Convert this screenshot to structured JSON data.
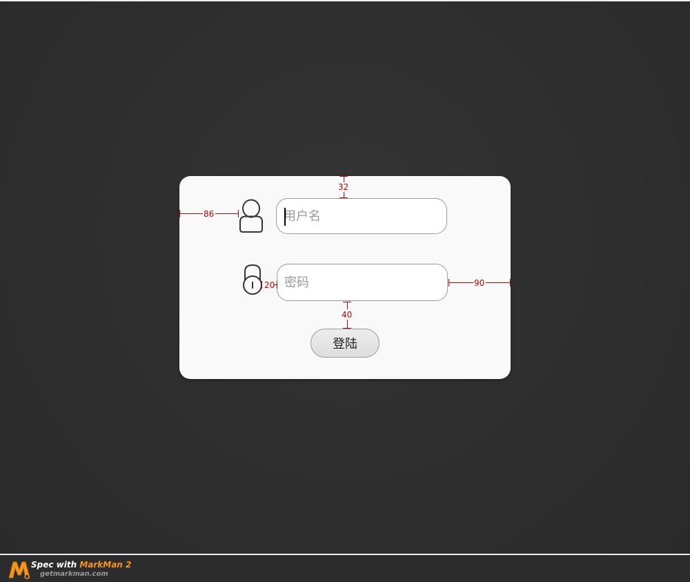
{
  "login_form": {
    "username": {
      "value": "",
      "placeholder": "用户名"
    },
    "password": {
      "value": "",
      "placeholder": "密码"
    },
    "login_label": "登陆"
  },
  "annotations": {
    "top_spacing": "32",
    "left_spacing": "86",
    "icon_gap": "20",
    "right_spacing": "90",
    "button_gap": "40"
  },
  "footer": {
    "spec_prefix": "Spec with ",
    "brand": "MarkMan 2",
    "url": "getmarkman.com"
  },
  "colors": {
    "background": "#2e2e2e",
    "card": "#f9f9f9",
    "annotation": "#cc0000",
    "brand": "#f7941d"
  },
  "icons": [
    "user-icon",
    "lock-icon",
    "markman-logo-icon"
  ]
}
